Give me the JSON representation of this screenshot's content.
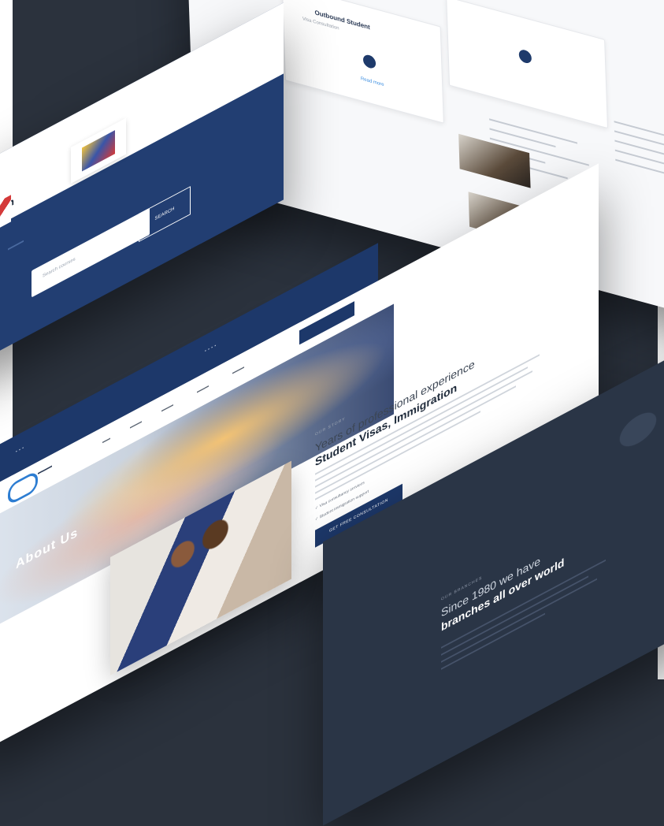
{
  "top_page": {
    "card1_title": "Outbound Student",
    "card1_sub": "Visa Consultation",
    "card1_link": "Read more"
  },
  "blue_page": {
    "title": "n",
    "search_placeholder": "Search courses",
    "search_button": "SEARCH"
  },
  "main_page": {
    "hero_title": "About Us",
    "kicker": "OUR STORY",
    "heading_light": "Years of professional experience",
    "heading_bold": "Student Visas, Immigration",
    "checks": [
      "Visa consultancy services",
      "Student immigration support"
    ],
    "cta": "GET FREE CONSULTATION"
  },
  "dark_page": {
    "kicker": "OUR BRANCHES",
    "heading_light": "Since 1980 we have",
    "heading_bold": "branches all over world"
  },
  "colors": {
    "navy": "#1d386a",
    "dark_band": "#2a3546",
    "background": "#2b323d"
  }
}
